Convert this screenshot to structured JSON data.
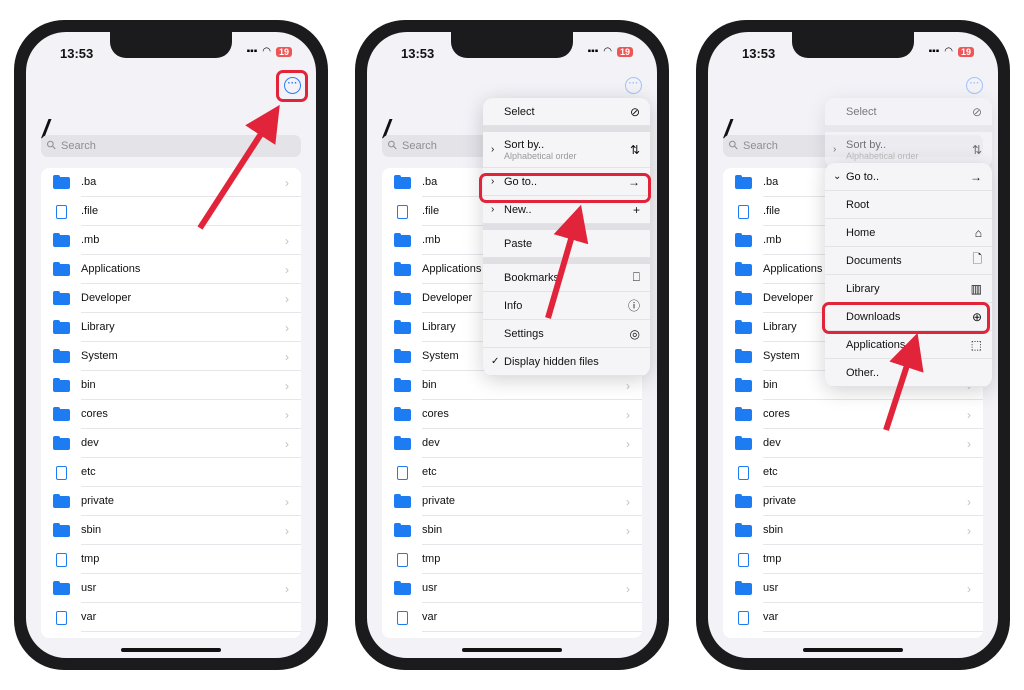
{
  "status": {
    "time": "13:53",
    "battery": "19"
  },
  "title": "/",
  "search_placeholder": "Search",
  "files": [
    {
      "name": ".ba",
      "type": "folder"
    },
    {
      "name": ".file",
      "type": "file"
    },
    {
      "name": ".mb",
      "type": "folder"
    },
    {
      "name": "Applications",
      "type": "folder"
    },
    {
      "name": "Developer",
      "type": "folder"
    },
    {
      "name": "Library",
      "type": "folder"
    },
    {
      "name": "System",
      "type": "folder"
    },
    {
      "name": "bin",
      "type": "folder"
    },
    {
      "name": "cores",
      "type": "folder"
    },
    {
      "name": "dev",
      "type": "folder"
    },
    {
      "name": "etc",
      "type": "file"
    },
    {
      "name": "private",
      "type": "folder"
    },
    {
      "name": "sbin",
      "type": "folder"
    },
    {
      "name": "tmp",
      "type": "file"
    },
    {
      "name": "usr",
      "type": "folder"
    },
    {
      "name": "var",
      "type": "file"
    }
  ],
  "menu": [
    {
      "label": "Select",
      "icon": "⊘",
      "icon_name": "checkmark-circle-icon"
    },
    {
      "gap": true
    },
    {
      "label": "Sort by..",
      "sub": "Alphabetical order",
      "icon": "⇅",
      "icon_name": "sort-icon",
      "pre": "›"
    },
    {
      "label": "Go to..",
      "icon": "→",
      "icon_name": "arrow-right-icon",
      "pre": "›"
    },
    {
      "label": "New..",
      "icon": "+",
      "icon_name": "plus-icon",
      "pre": "›"
    },
    {
      "gap": true
    },
    {
      "label": "Paste"
    },
    {
      "gap": true
    },
    {
      "label": "Bookmarks",
      "icon": "⎕",
      "icon_name": "bookmark-icon"
    },
    {
      "label": "Info",
      "icon": "ⓘ",
      "icon_name": "info-icon"
    },
    {
      "label": "Settings",
      "icon": "◎",
      "icon_name": "settings-icon"
    },
    {
      "label": "Display hidden files",
      "pre": "✓"
    }
  ],
  "goto_menu": [
    {
      "label": "Go to..",
      "icon": "→",
      "icon_name": "arrow-right-icon",
      "pre": "⌄"
    },
    {
      "label": "Root"
    },
    {
      "label": "Home",
      "icon": "⌂",
      "icon_name": "house-icon"
    },
    {
      "label": "Documents",
      "icon": "🗋",
      "icon_name": "document-icon"
    },
    {
      "label": "Library",
      "icon": "▥",
      "icon_name": "books-icon"
    },
    {
      "label": "Downloads",
      "icon": "⊕",
      "icon_name": "download-icon"
    },
    {
      "label": "Applications",
      "icon": "⬚",
      "icon_name": "dashed-square-icon"
    },
    {
      "label": "Other.."
    }
  ],
  "colors": {
    "accent": "#1e7cf2",
    "highlight": "#e1243a"
  }
}
